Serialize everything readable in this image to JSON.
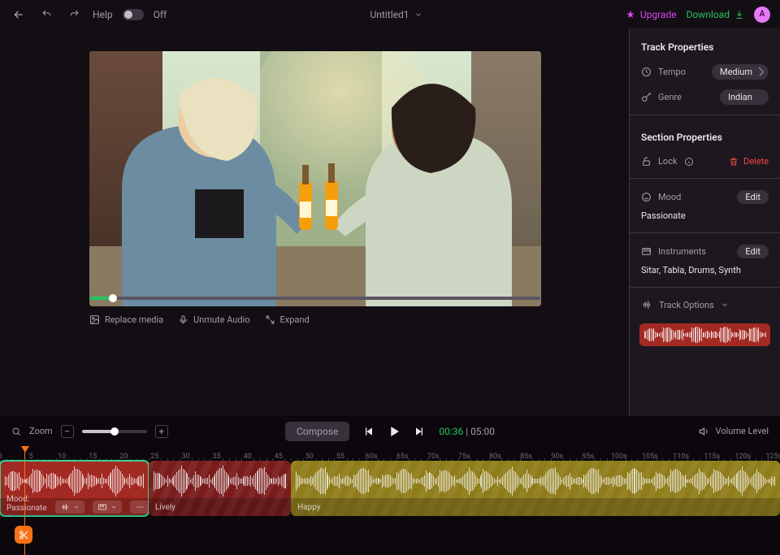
{
  "header": {
    "help_label": "Help",
    "toggle_label": "Off",
    "title": "Untitled1",
    "upgrade_label": "Upgrade",
    "download_label": "Download",
    "avatar_letter": "A"
  },
  "stage": {
    "replace_media_label": "Replace media",
    "unmute_audio_label": "Unmute Audio",
    "expand_label": "Expand"
  },
  "panel": {
    "track_properties_title": "Track Properties",
    "tempo_label": "Tempo",
    "tempo_value": "Medium",
    "genre_label": "Genre",
    "genre_value": "Indian",
    "section_properties_title": "Section Properties",
    "lock_label": "Lock",
    "delete_label": "Delete",
    "mood_label": "Mood",
    "mood_edit_label": "Edit",
    "mood_value": "Passionate",
    "instruments_label": "Instruments",
    "instruments_edit_label": "Edit",
    "instruments_value": "Sitar, Tabla, Drums, Synth",
    "track_options_label": "Track Options"
  },
  "playbar": {
    "zoom_label": "Zoom",
    "minus": "−",
    "plus": "+",
    "compose_label": "Compose",
    "elapsed": "00:36",
    "separator": " | ",
    "total": "05:00",
    "volume_label": "Volume Level"
  },
  "timeline": {
    "playhead_seconds": 4,
    "visible_seconds": 126,
    "tick_interval": 5,
    "sections": [
      {
        "start": 0,
        "end": 24,
        "label": "Mood: Passionate",
        "color": "#a32a23",
        "selected": true,
        "footer_buttons": true
      },
      {
        "start": 24,
        "end": 47,
        "label": "Lively",
        "color": "#7a1c1c",
        "selected": false,
        "footer_buttons": false
      },
      {
        "start": 47,
        "end": 126,
        "label": "Happy",
        "color": "#8f7d1b",
        "selected": false,
        "footer_buttons": false
      }
    ]
  }
}
